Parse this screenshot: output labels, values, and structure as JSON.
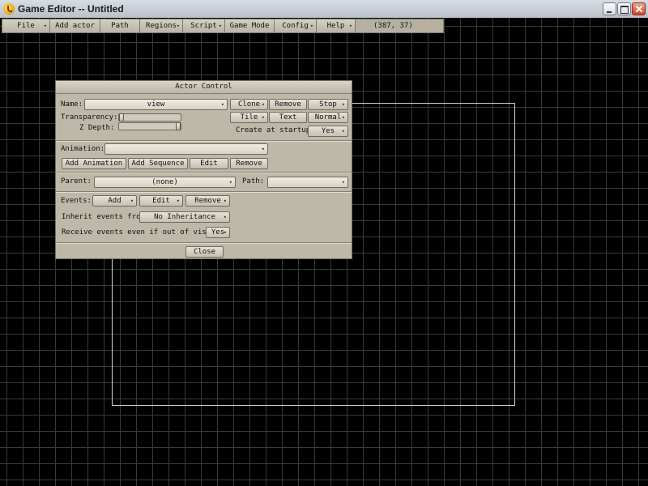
{
  "window": {
    "title": "Game Editor -- Untitled"
  },
  "menubar": {
    "items": [
      {
        "label": "File",
        "has_dropdown": true
      },
      {
        "label": "Add actor",
        "has_dropdown": false
      },
      {
        "label": "Path",
        "has_dropdown": false
      },
      {
        "label": "Regions",
        "has_dropdown": true
      },
      {
        "label": "Script",
        "has_dropdown": true
      },
      {
        "label": "Game Mode",
        "has_dropdown": false
      },
      {
        "label": "Config",
        "has_dropdown": true
      },
      {
        "label": "Help",
        "has_dropdown": true
      }
    ],
    "coords": "(387, 37)"
  },
  "dialog": {
    "title": "Actor Control",
    "name_label": "Name:",
    "name_value": "view",
    "clone_label": "Clone",
    "remove_label": "Remove",
    "stop_label": "Stop",
    "transparency_label": "Transparency:",
    "transparency_value": 0,
    "zdepth_label": "Z Depth:",
    "zdepth_value": 1,
    "tile_label": "Tile",
    "text_label": "Text",
    "normal_label": "Normal",
    "create_startup_label": "Create at startup:",
    "create_startup_value": "Yes",
    "animation_label": "Animation:",
    "animation_value": "",
    "add_animation_label": "Add Animation",
    "add_sequence_label": "Add Sequence",
    "edit_anim_label": "Edit",
    "remove_anim_label": "Remove",
    "parent_label": "Parent:",
    "parent_value": "(none)",
    "path_label": "Path:",
    "path_value": "",
    "events_label": "Events:",
    "events_add_label": "Add",
    "events_edit_label": "Edit",
    "events_remove_label": "Remove",
    "inherit_label": "Inherit events from:",
    "inherit_value": "No Inheritance",
    "receive_label": "Receive events even if out of vision:",
    "receive_value": "Yes",
    "close_label": "Close"
  },
  "icons": {
    "dropdown_arrow": "▾"
  },
  "colors": {
    "dialog_bg": "#bdb8a8",
    "canvas_bg": "#000000",
    "grid_line": "#3a3a3a",
    "view_border": "#cfcfcf"
  }
}
